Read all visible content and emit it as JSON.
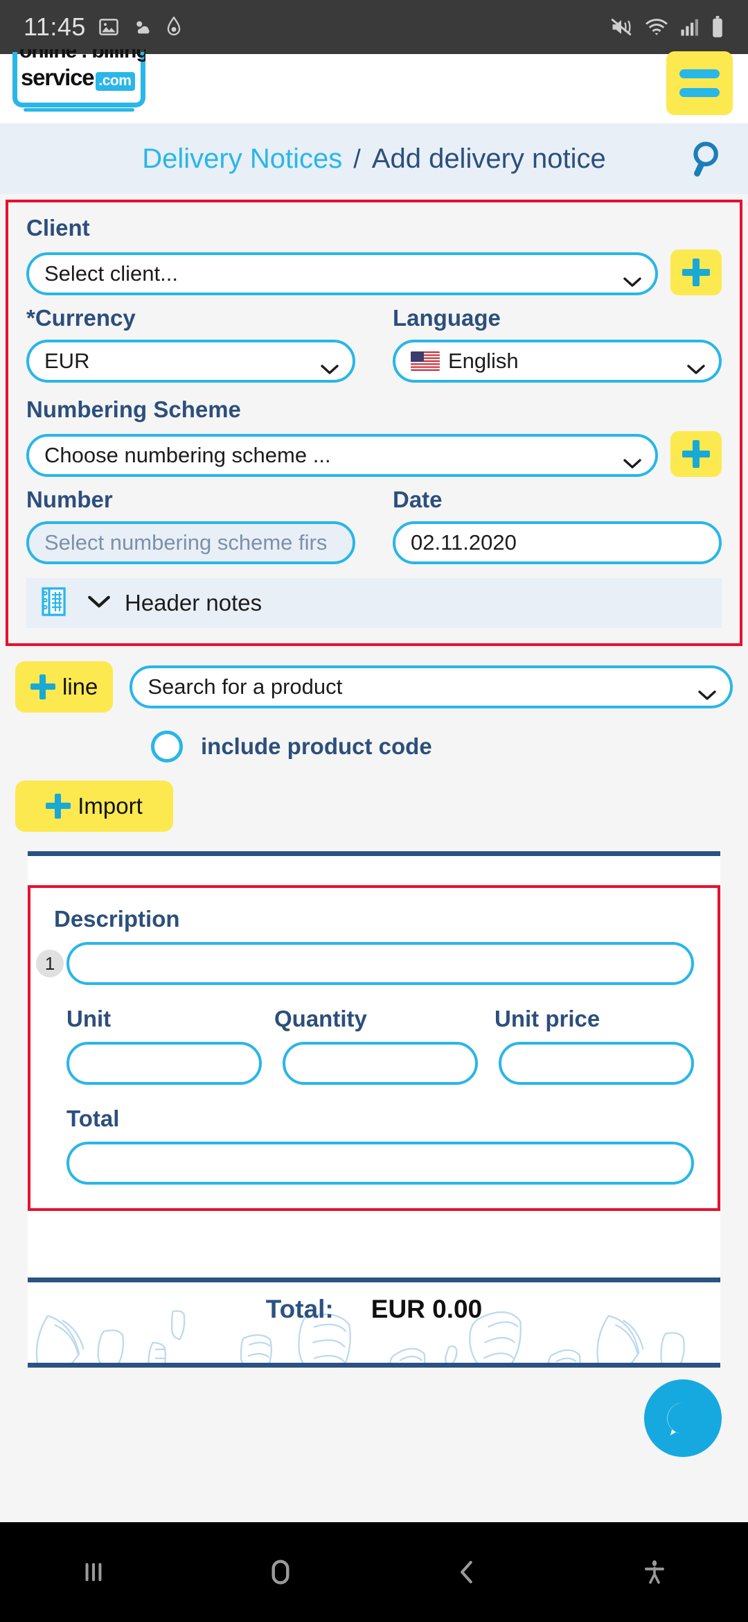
{
  "status_bar": {
    "clock": "11:45",
    "left_icons": [
      "image-icon",
      "weather-icon",
      "app-icon"
    ],
    "right_icons": [
      "mute-icon",
      "wifi-icon",
      "signal-icon",
      "battery-icon"
    ]
  },
  "app_header": {
    "logo_line1": "online . billing",
    "logo_line2": "service",
    "logo_tld": ".com",
    "menu_icon": "hamburger-menu-icon"
  },
  "breadcrumb": {
    "parent": "Delivery Notices",
    "separator": "/",
    "current": "Add delivery notice",
    "search_icon": "search-icon"
  },
  "form": {
    "client": {
      "label": "Client",
      "value": "Select client...",
      "add_button": "add-client-button"
    },
    "currency": {
      "label": "Currency",
      "required_mark": "*",
      "value": "EUR"
    },
    "language": {
      "label": "Language",
      "value": "English",
      "flag": "us-flag-icon"
    },
    "numbering_scheme": {
      "label": "Numbering Scheme",
      "value": "Choose numbering scheme ...",
      "add_button": "add-numbering-scheme-button"
    },
    "number": {
      "label": "Number",
      "placeholder": "Select numbering scheme firs"
    },
    "date": {
      "label": "Date",
      "value": "02.11.2020"
    },
    "header_notes": {
      "label": "Header notes",
      "icon": "notebook-icon",
      "chevron": "chevron-down-icon"
    }
  },
  "lines_toolbar": {
    "add_line_label": "line",
    "product_search_placeholder": "Search for a product",
    "include_product_code_label": "include product code",
    "include_product_code_checked": false,
    "import_label": "Import"
  },
  "line_item": {
    "row_number": "1",
    "description_label": "Description",
    "description_value": "",
    "unit_label": "Unit",
    "unit_value": "",
    "quantity_label": "Quantity",
    "quantity_value": "",
    "unit_price_label": "Unit price",
    "unit_price_value": "",
    "total_label": "Total",
    "total_value": ""
  },
  "footer": {
    "total_label": "Total:",
    "total_value": "EUR 0.00",
    "chat_icon": "chat-bubble-icon"
  },
  "nav_bar": {
    "recents": "recents-icon",
    "home": "home-icon",
    "back": "back-icon",
    "accessibility": "accessibility-icon"
  },
  "colors": {
    "accent_cyan": "#29b6e8",
    "accent_yellow": "#fce94f",
    "navy": "#2c4f7c",
    "highlight_red": "#e8102e"
  }
}
